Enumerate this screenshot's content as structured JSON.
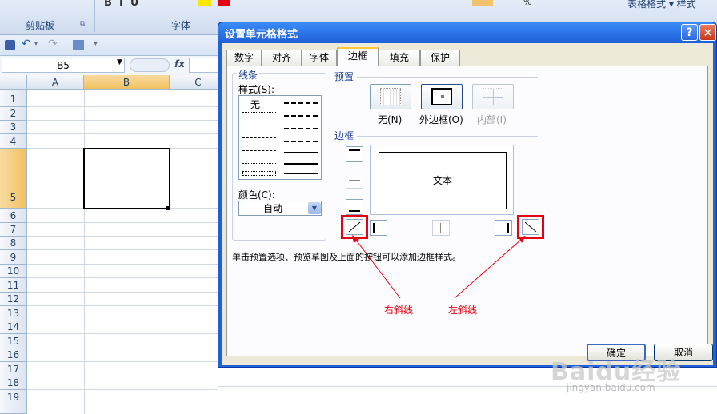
{
  "ribbon": {
    "clipboard_label": "剪贴板",
    "font_label": "字体",
    "right_items": "表格格式 ▾ 样式",
    "percent": "%"
  },
  "formula_bar": {
    "name_box": "B5",
    "fx": "fx"
  },
  "grid": {
    "columns": [
      "A",
      "B",
      "C"
    ],
    "rows": [
      "1",
      "2",
      "3",
      "4",
      "5",
      "6",
      "7",
      "8",
      "9",
      "10",
      "11",
      "12",
      "13",
      "14",
      "15",
      "16",
      "17",
      "18",
      "19"
    ]
  },
  "dialog": {
    "title": "设置单元格格式",
    "help": "?",
    "close": "×",
    "tabs": [
      "数字",
      "对齐",
      "字体",
      "边框",
      "填充",
      "保护"
    ],
    "active_tab": "边框",
    "line_section": "线条",
    "style_label": "样式(S):",
    "style_none": "无",
    "color_label": "颜色(C):",
    "color_value": "自动",
    "presets_section": "预置",
    "preset_none": "无(N)",
    "preset_outline": "外边框(O)",
    "preset_inside": "内部(I)",
    "border_section": "边框",
    "preview_text": "文本",
    "hint": "单击预置选项、预览草图及上面的按钮可以添加边框样式。",
    "ok": "确定",
    "cancel": "取消"
  },
  "annotations": {
    "right_diagonal": "右斜线",
    "left_diagonal": "左斜线"
  },
  "watermark": {
    "brand": "Baidu经验",
    "url": "jingyan.baidu.com"
  },
  "colors": {
    "accent": "#1e5fd8",
    "annotation": "#e60012",
    "selected_header": "#f1c15f"
  }
}
